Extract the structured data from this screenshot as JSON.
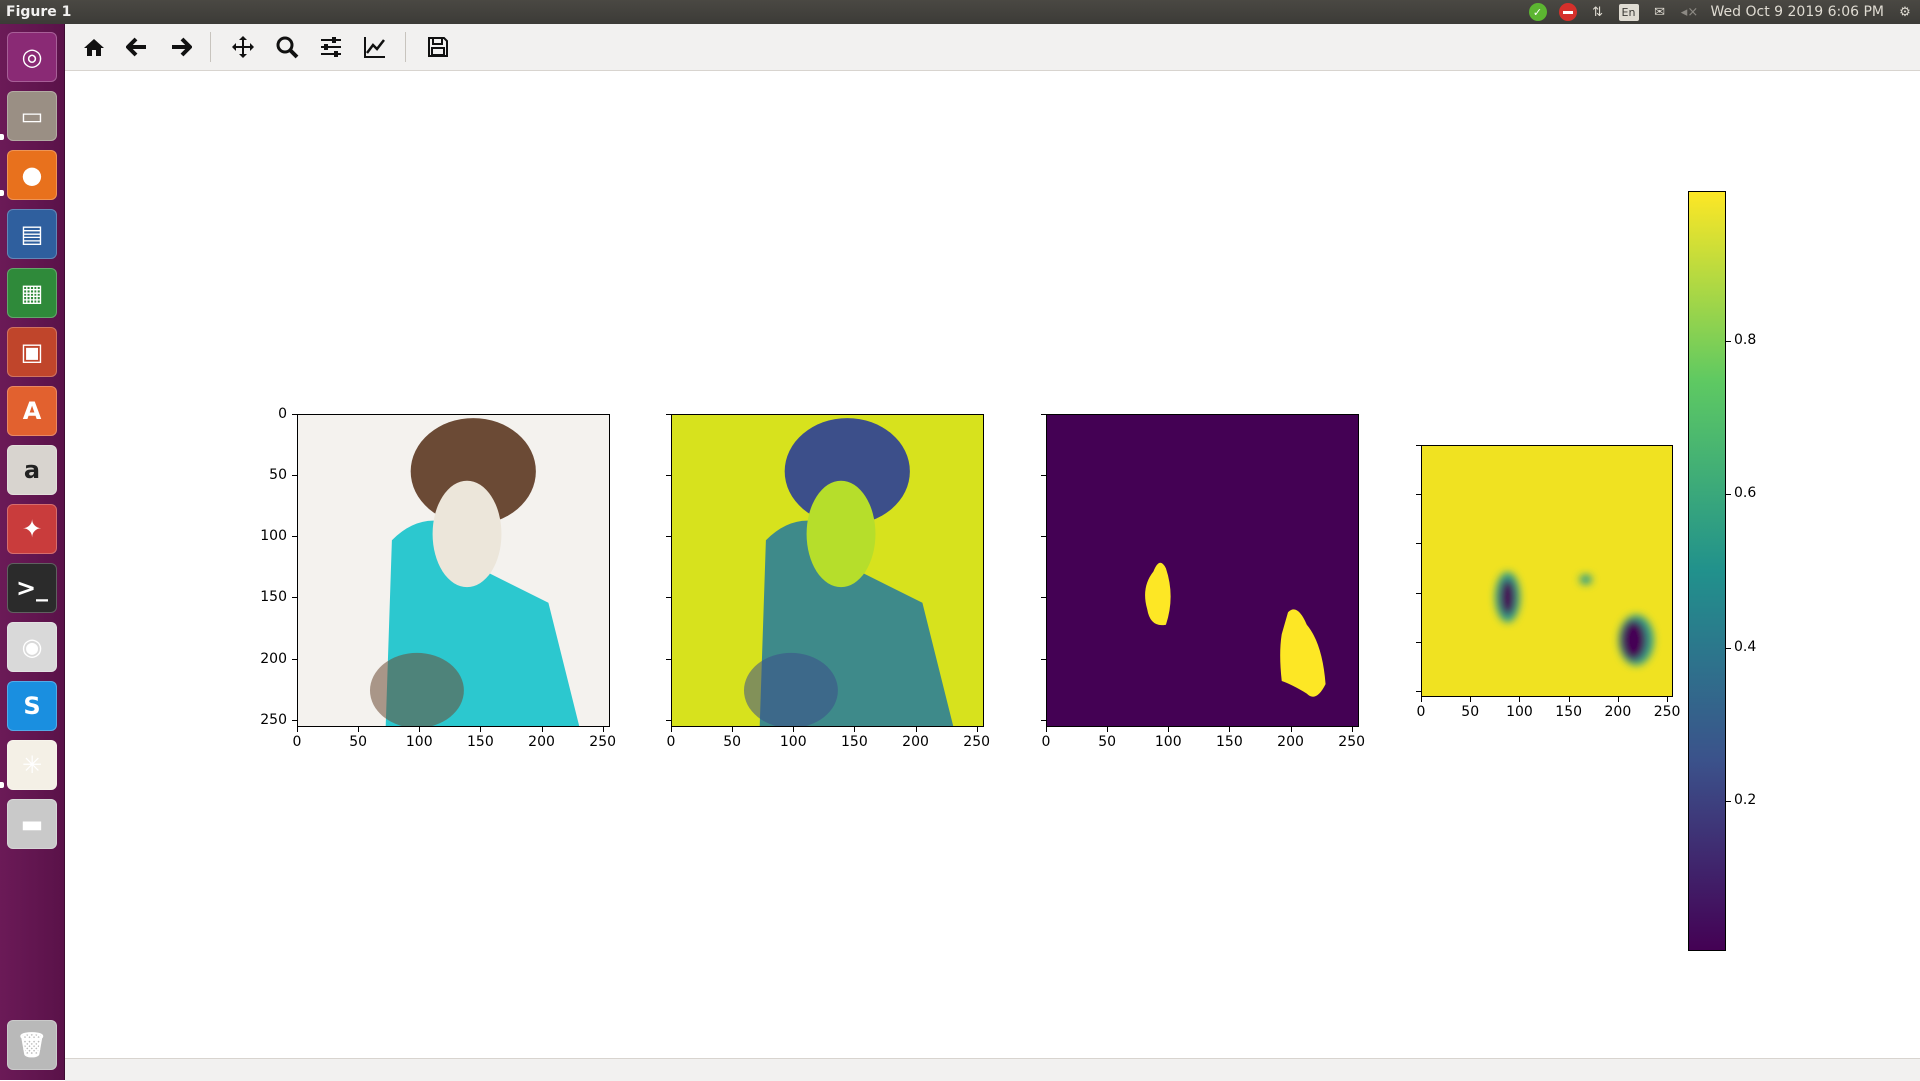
{
  "window": {
    "title": "Figure 1"
  },
  "panel": {
    "clock": "Wed Oct  9 2019  6:06 PM",
    "language": "En"
  },
  "launcher": {
    "items": [
      {
        "name": "ubuntu-dash-icon",
        "bg": "#8a2a75",
        "glyph": "◎"
      },
      {
        "name": "files-icon",
        "bg": "#9a8f84",
        "glyph": "▭"
      },
      {
        "name": "firefox-icon",
        "bg": "#e8711d",
        "glyph": "●"
      },
      {
        "name": "writer-icon",
        "bg": "#2f5f9e",
        "glyph": "▤"
      },
      {
        "name": "calc-icon",
        "bg": "#2f8a3a",
        "glyph": "▦"
      },
      {
        "name": "impress-icon",
        "bg": "#c0452b",
        "glyph": "▣"
      },
      {
        "name": "software-center-icon",
        "bg": "#e2612f",
        "glyph": "A"
      },
      {
        "name": "amazon-icon",
        "bg": "#d8d4cf",
        "glyph": "a"
      },
      {
        "name": "system-settings-icon",
        "bg": "#c93c3c",
        "glyph": "✦"
      },
      {
        "name": "terminal-icon",
        "bg": "#2b2b2b",
        "glyph": ">_"
      },
      {
        "name": "chrome-icon",
        "bg": "#d9d9d9",
        "glyph": "◉"
      },
      {
        "name": "skype-icon",
        "bg": "#1a8fe0",
        "glyph": "S"
      },
      {
        "name": "app-pinwheel-icon",
        "bg": "#f4f0e6",
        "glyph": "✳"
      },
      {
        "name": "disk-icon",
        "bg": "#c9c9c9",
        "glyph": "▬"
      },
      {
        "name": "trash-icon",
        "bg": "#b9b9b9",
        "glyph": "🗑"
      }
    ]
  },
  "toolbar": {
    "buttons": [
      "home",
      "back",
      "forward",
      "pan",
      "zoom",
      "configure-subplots",
      "edit-axes",
      "save"
    ]
  },
  "plots": [
    {
      "name": "original-image-axes",
      "colors": [
        "#f4f2ee",
        "#2cc8cf",
        "#6b4a35",
        "#ece6da"
      ],
      "xticks": [
        "0",
        "50",
        "100",
        "150",
        "200",
        "250"
      ],
      "yticks": [
        "0",
        "50",
        "100",
        "150",
        "200",
        "250"
      ]
    },
    {
      "name": "grayscale-viridis-axes",
      "colors": [
        "#d7e21d",
        "#3e8a8a",
        "#3c4f8a",
        "#b6de2b"
      ],
      "xticks": [
        "0",
        "50",
        "100",
        "150",
        "200",
        "250"
      ],
      "yticks": [
        "",
        "",
        "",
        "",
        "",
        ""
      ]
    },
    {
      "name": "mask-axes",
      "colors": [
        "#440154",
        "#fde725"
      ],
      "xticks": [
        "0",
        "50",
        "100",
        "150",
        "200",
        "250"
      ],
      "yticks": [
        "",
        "",
        "",
        "",
        "",
        ""
      ]
    },
    {
      "name": "prediction-axes",
      "colors": [
        "#f0e221",
        "#440154",
        "#2a9d8a"
      ],
      "xticks": [
        "0",
        "50",
        "100",
        "150",
        "200",
        "250"
      ],
      "yticks": [
        "",
        "",
        "",
        "",
        "",
        ""
      ]
    }
  ],
  "colorbar": {
    "ticks": [
      "0.8",
      "0.6",
      "0.4",
      "0.2"
    ],
    "colors": [
      "#fde725",
      "#5ec962",
      "#21918c",
      "#3b528b",
      "#440154"
    ]
  }
}
